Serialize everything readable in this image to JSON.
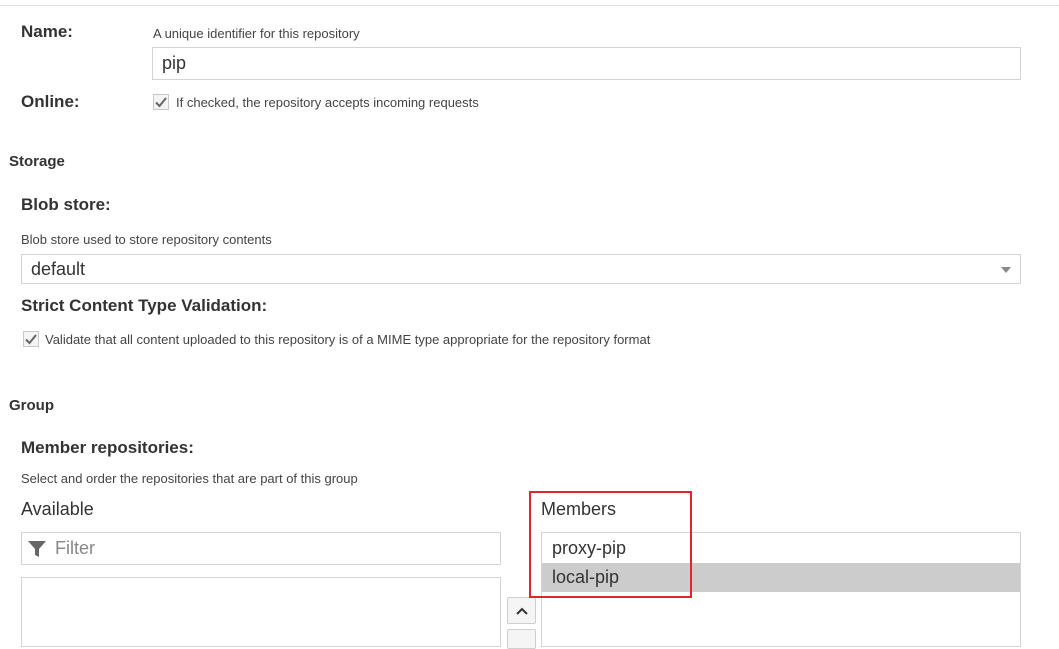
{
  "name_field": {
    "label": "Name:",
    "help": "A unique identifier for this repository",
    "value": "pip"
  },
  "online_field": {
    "label": "Online:",
    "checkbox_label": "If checked, the repository accepts incoming requests",
    "checked": true
  },
  "storage": {
    "section_title": "Storage",
    "blob_store": {
      "label": "Blob store:",
      "help": "Blob store used to store repository contents",
      "selected": "default"
    },
    "strict_validation": {
      "label": "Strict Content Type Validation:",
      "checkbox_label": "Validate that all content uploaded to this repository is of a MIME type appropriate for the repository format",
      "checked": true
    }
  },
  "group": {
    "section_title": "Group",
    "member_repositories": {
      "label": "Member repositories:",
      "help": "Select and order the repositories that are part of this group",
      "available": {
        "title": "Available",
        "filter_placeholder": "Filter",
        "items": []
      },
      "members": {
        "title": "Members",
        "items": [
          "proxy-pip",
          "local-pip"
        ],
        "selected_index": 1
      }
    }
  },
  "icons": {
    "filter": "filter-icon",
    "checkmark": "checkmark-icon",
    "dropdown": "chevron-down-icon",
    "move_up": "chevron-up-icon"
  },
  "colors": {
    "highlight_box": "#e0262d",
    "selected_row": "#cccccc",
    "border": "#d4d4d4"
  }
}
